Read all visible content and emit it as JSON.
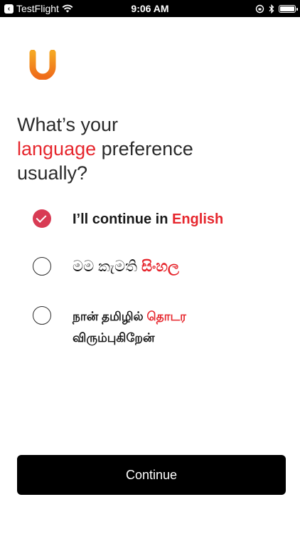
{
  "status_bar": {
    "back_app": "TestFlight",
    "time": "9:06 AM"
  },
  "logo": {
    "letter": "U"
  },
  "heading": {
    "line1": "What’s your",
    "line2_accent": "language",
    "line2_rest": " preference",
    "line3": "usually?"
  },
  "options": [
    {
      "prefix": "I’ll continue in ",
      "accent": "English",
      "selected": true
    },
    {
      "prefix": "මම කැමති ",
      "accent": "සිංහල",
      "selected": false
    },
    {
      "prefix": "நான் தமிழில் ",
      "accent": "தொடர",
      "suffix": "விரும்புகிறேன்",
      "selected": false
    }
  ],
  "continue_label": "Continue",
  "colors": {
    "accent": "#e6262d",
    "selected": "#d83b54",
    "button": "#000000"
  }
}
